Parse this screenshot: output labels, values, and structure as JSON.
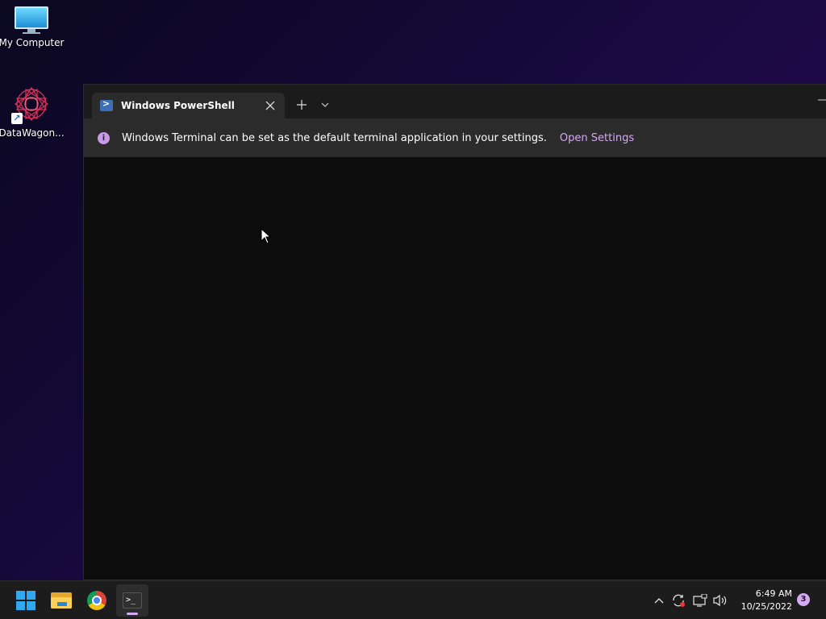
{
  "desktop": {
    "icons": [
      {
        "label": "My Computer",
        "icon": "monitor-icon"
      },
      {
        "label": "DataWagon...",
        "icon": "datawagon-logo-icon"
      }
    ]
  },
  "terminal": {
    "tab": {
      "label": "Windows PowerShell",
      "icon": "powershell-icon"
    },
    "new_tab_symbol": "+",
    "dropdown_symbol": "⌵",
    "minimize_symbol": "—",
    "infobar": {
      "icon_symbol": "i",
      "message": "Windows Terminal can be set as the default terminal application in your settings.",
      "link": "Open Settings"
    }
  },
  "taskbar": {
    "apps": [
      {
        "name": "Start",
        "icon": "windows-logo-icon"
      },
      {
        "name": "File Explorer",
        "icon": "folder-icon"
      },
      {
        "name": "Google Chrome",
        "icon": "chrome-icon"
      },
      {
        "name": "Windows Terminal",
        "icon": "terminal-icon",
        "active": true
      }
    ],
    "clock": {
      "time": "6:49 AM",
      "date": "10/25/2022"
    },
    "notification_count": "3"
  },
  "colors": {
    "accent": "#d6aaf2",
    "infobar_bg": "#2b2b2b",
    "terminal_bg": "#0c0c0c",
    "taskbar_bg": "#1c1c1c"
  }
}
